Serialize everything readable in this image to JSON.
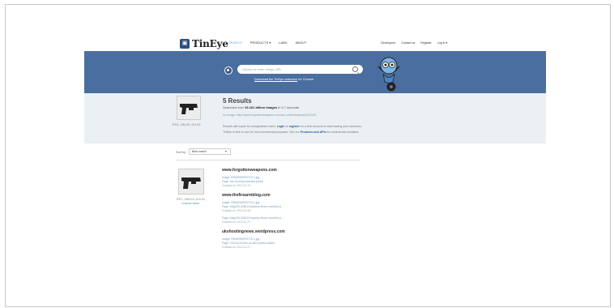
{
  "nav": {
    "logo_text": "TinEye",
    "links": [
      "SEARCH",
      "PRODUCTS",
      "LABS",
      "ABOUT"
    ],
    "products_caret": "▾",
    "right": [
      "Developers",
      "Contact us",
      "Register",
      "Log in ▾"
    ]
  },
  "banner": {
    "search_placeholder": "Upload or enter image URL",
    "extension_link": "Download the TinEye extension",
    "extension_suffix": " for Chrome"
  },
  "summary": {
    "title": "5 Results",
    "searched_prefix": "Searched over ",
    "searched_count": "16.161 billion images",
    "searched_suffix": " in 0.7 seconds.",
    "for_image": "for image: http://www.forgottenweapons.com/wp-content/uploads/2013/0...",
    "thumb_meta": "JPEG, 198x153, 49.6 KB",
    "note1_a": "Results will expire for unregistered users. ",
    "note1_login": "Login",
    "note1_b": " or ",
    "note1_register": "register",
    "note1_c": " for a free account to start saving your searches.",
    "note2_a": "TinEye is free to use for non-commercial purposes. See our ",
    "note2_link": "Products and APIs",
    "note2_b": " for commercial solutions."
  },
  "sort": {
    "label": "Sort by:",
    "selected": "Best match"
  },
  "match": {
    "thumb_meta": "JPEG, 198x153, 49.6 KB",
    "compare": "Compare Match"
  },
  "results": [
    {
      "domain": "www.forgottenweapons.com",
      "lines": [
        {
          "text": "Image: RRAIRMSPISTOL1.jpg",
          "date": false
        },
        {
          "text": "Page: the-rft-army-machine-pistol/",
          "date": false
        },
        {
          "text": "Crawled on 2013-10-31",
          "date": true
        }
      ]
    },
    {
      "domain": "www.thefirearmblog.com",
      "lines": [
        {
          "text": "Image: RRAIRMSPISTOL1.jpg",
          "date": false
        },
        {
          "text": "Page: blog/2013/08/11/mystery-firmin-machine-p...",
          "date": false
        },
        {
          "text": "Crawled on 2013-10-30",
          "date": true
        },
        {
          "text": "",
          "date": false
        },
        {
          "text": "Page: blog/2013/08/11/mystery-firmin-machine-p...",
          "date": false
        },
        {
          "text": "Crawled on 2013-11-27",
          "date": true
        }
      ]
    },
    {
      "domain": "ukshootingnews.wordpress.com",
      "lines": [
        {
          "text": "Image: RRAIRMSPISTOL1.jpg",
          "date": false
        },
        {
          "text": "Page: 2013/11/11/the-ss-self-publish-article...",
          "date": false
        },
        {
          "text": "Crawled on 2013-11-27",
          "date": true
        }
      ]
    }
  ]
}
